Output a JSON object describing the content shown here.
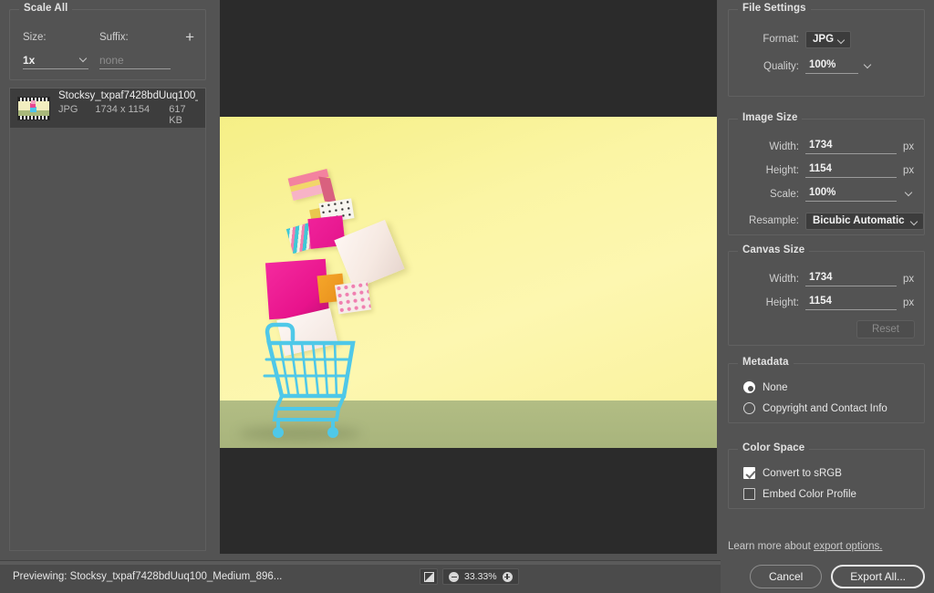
{
  "sidebar": {
    "scale_all": {
      "title": "Scale All",
      "size_label": "Size:",
      "size_value": "1x",
      "suffix_label": "Suffix:",
      "suffix_placeholder": "none",
      "add_label": "+"
    },
    "files": [
      {
        "name": "Stocksy_txpaf7428bdUuq100_...",
        "format": "JPG",
        "dimensions": "1734 x 1154",
        "size": "617 KB"
      }
    ]
  },
  "preview": {
    "image_alt": "Blue shopping cart with colorful falling gift boxes on yellow background"
  },
  "right_panel": {
    "file_settings": {
      "title": "File Settings",
      "format_label": "Format:",
      "format_value": "JPG",
      "quality_label": "Quality:",
      "quality_value": "100%"
    },
    "image_size": {
      "title": "Image Size",
      "width_label": "Width:",
      "width_value": "1734",
      "width_unit": "px",
      "height_label": "Height:",
      "height_value": "1154",
      "height_unit": "px",
      "scale_label": "Scale:",
      "scale_value": "100%",
      "resample_label": "Resample:",
      "resample_value": "Bicubic Automatic"
    },
    "canvas_size": {
      "title": "Canvas Size",
      "width_label": "Width:",
      "width_value": "1734",
      "width_unit": "px",
      "height_label": "Height:",
      "height_value": "1154",
      "height_unit": "px",
      "reset_label": "Reset"
    },
    "metadata": {
      "title": "Metadata",
      "option_none": "None",
      "option_copyright": "Copyright and Contact Info"
    },
    "color_space": {
      "title": "Color Space",
      "convert_srgb": "Convert to sRGB",
      "embed_profile": "Embed Color Profile"
    },
    "learn_more_prefix": "Learn more about ",
    "learn_more_link": "export options.",
    "cancel_label": "Cancel",
    "export_label": "Export All..."
  },
  "statusbar": {
    "preview_label": "Previewing:",
    "preview_file": "Stocksy_txpaf7428bdUuq100_Medium_896...",
    "zoom_value": "33.33%"
  },
  "colors": {
    "panel_bg": "#535353",
    "canvas_bg": "#2b2b2b",
    "statusbar_bg": "#4b4b4b",
    "text": "#e8e8e8",
    "field_underline": "#9b9b9b",
    "art_yellow": "#f8f29c",
    "art_floor": "#aab67e",
    "art_cart_blue": "#4fc8e8",
    "art_magenta": "#ee1b95"
  }
}
